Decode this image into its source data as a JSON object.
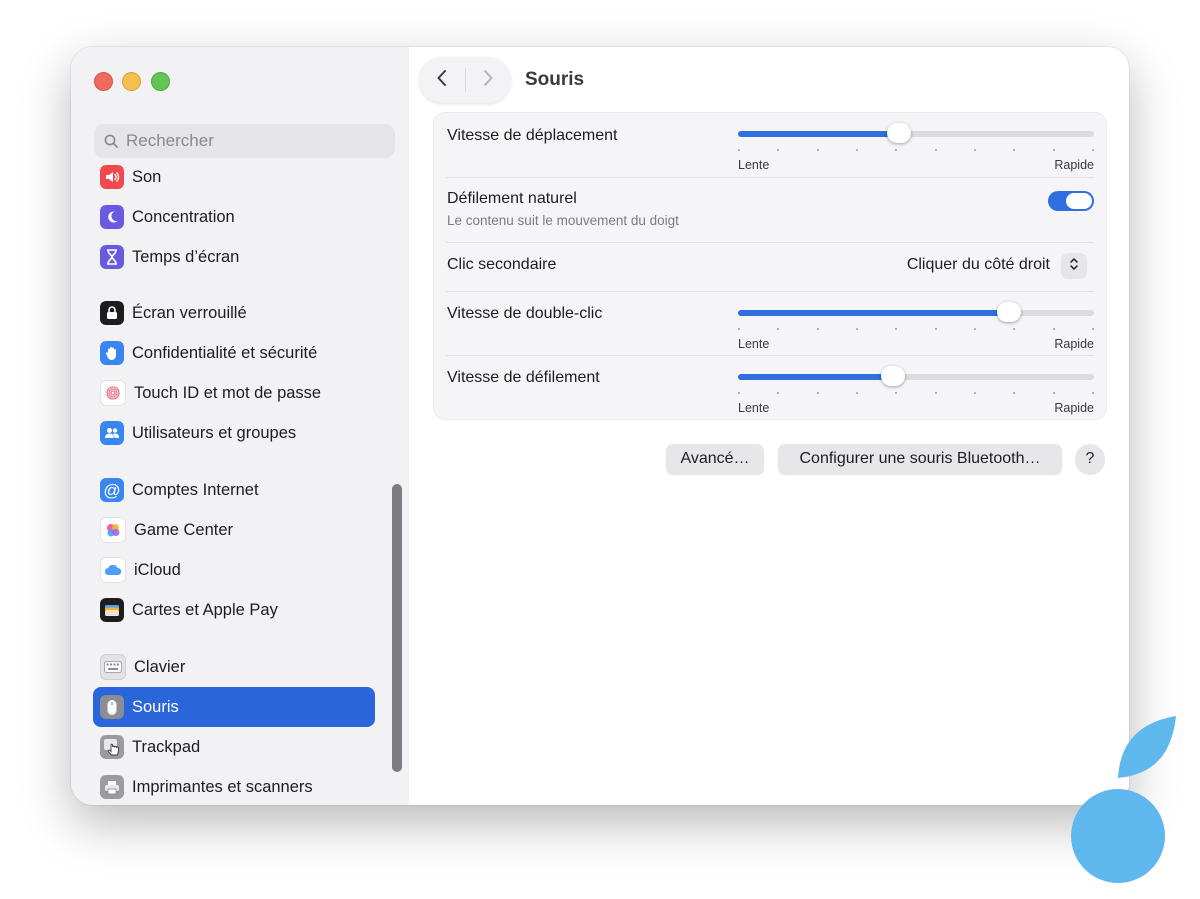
{
  "sidebar": {
    "search_placeholder": "Rechercher",
    "items": [
      {
        "label": "Son",
        "icon": "speaker-icon",
        "color": "#f0484f"
      },
      {
        "label": "Concentration",
        "icon": "moon-icon",
        "color": "#6a5ae0"
      },
      {
        "label": "Temps d’écran",
        "icon": "hourglass-icon",
        "color": "#6a5ae0"
      },
      {
        "label": "Écran verrouillé",
        "icon": "lock-icon",
        "color": "#1d1d1f"
      },
      {
        "label": "Confidentialité et sécurité",
        "icon": "hand-icon",
        "color": "#3a86f0"
      },
      {
        "label": "Touch ID et mot de passe",
        "icon": "fingerprint-icon",
        "color": "#ffffff"
      },
      {
        "label": "Utilisateurs et groupes",
        "icon": "users-icon",
        "color": "#3a86f0"
      },
      {
        "label": "Comptes Internet",
        "icon": "at-icon",
        "color": "#3a86f0"
      },
      {
        "label": "Game Center",
        "icon": "game-center-icon",
        "color": "#ffffff"
      },
      {
        "label": "iCloud",
        "icon": "cloud-icon",
        "color": "#ffffff"
      },
      {
        "label": "Cartes et Apple Pay",
        "icon": "wallet-icon",
        "color": "#1d1d1f"
      },
      {
        "label": "Clavier",
        "icon": "keyboard-icon",
        "color": "#d9d9dc"
      },
      {
        "label": "Souris",
        "icon": "mouse-icon",
        "color": "#9a9aa0",
        "selected": true
      },
      {
        "label": "Trackpad",
        "icon": "trackpad-icon",
        "color": "#9a9aa0"
      },
      {
        "label": "Imprimantes et scanners",
        "icon": "printer-icon",
        "color": "#9a9aa0"
      }
    ]
  },
  "toolbar": {
    "title": "Souris",
    "back_icon": "chevron-left-icon",
    "forward_icon": "chevron-right-icon"
  },
  "settings": {
    "tracking_speed": {
      "label": "Vitesse de déplacement",
      "min_label": "Lente",
      "max_label": "Rapide",
      "value": 0.45
    },
    "natural_scrolling": {
      "label": "Défilement naturel",
      "description": "Le contenu suit le mouvement du doigt",
      "enabled": true
    },
    "secondary_click": {
      "label": "Clic secondaire",
      "value": "Cliquer du côté droit"
    },
    "double_click_speed": {
      "label": "Vitesse de double-clic",
      "min_label": "Lente",
      "max_label": "Rapide",
      "value": 0.78
    },
    "scroll_speed": {
      "label": "Vitesse de défilement",
      "min_label": "Lente",
      "max_label": "Rapide",
      "value": 0.43
    }
  },
  "buttons": {
    "advanced": "Avancé…",
    "bluetooth": "Configurer une souris Bluetooth…",
    "help": "?"
  },
  "colors": {
    "accent": "#2f6fde",
    "selection": "#2a66d9"
  }
}
